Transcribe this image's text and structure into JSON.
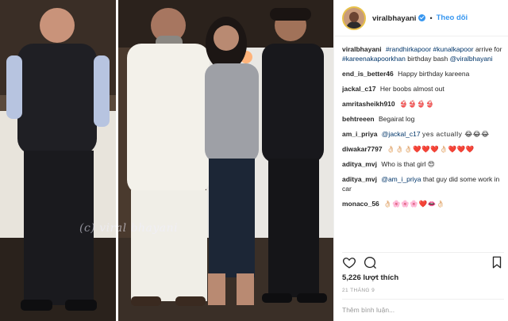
{
  "post": {
    "watermark": "(c) viral bhayani"
  },
  "header": {
    "username": "viralbhayani",
    "follow_label": "Theo dõi",
    "dot": "•"
  },
  "caption": {
    "username": "viralbhayani",
    "text_1": "#randhirkapoor #kunalkapoor",
    "text_2": "arrive for",
    "text_3": "#kareenakapoorkhan",
    "text_4": "birthday bash",
    "text_5": "@viralbhayani"
  },
  "comments": [
    {
      "user": "end_is_better46",
      "text": "Happy birthday kareena"
    },
    {
      "user": "jackal_c17",
      "text": "Her boobs almost out"
    },
    {
      "user": "amritasheikh910",
      "text": "👙👙👙👙"
    },
    {
      "user": "behtreeen",
      "text": "Begairat log"
    },
    {
      "user": "am_i_priya",
      "mention": "@jackal_c17",
      "text": "yes actually 😂😂😂"
    },
    {
      "user": "diwakar7797",
      "text": "👌🏻👌🏻👌🏻❤️❤️❤️👌🏻❤️❤️❤️"
    },
    {
      "user": "aditya_mvj",
      "text": "Who is that girl 😍"
    },
    {
      "user": "aditya_mvj",
      "mention": "@am_i_priya",
      "text": "that guy did some work in car"
    },
    {
      "user": "monaco_56",
      "text": "👌🏻🌸🌸🌸❤️👄👌🏻"
    }
  ],
  "likes": "5,226 lượt thích",
  "date": "21 THÁNG 9",
  "add_comment_placeholder": "Thêm bình luận..."
}
